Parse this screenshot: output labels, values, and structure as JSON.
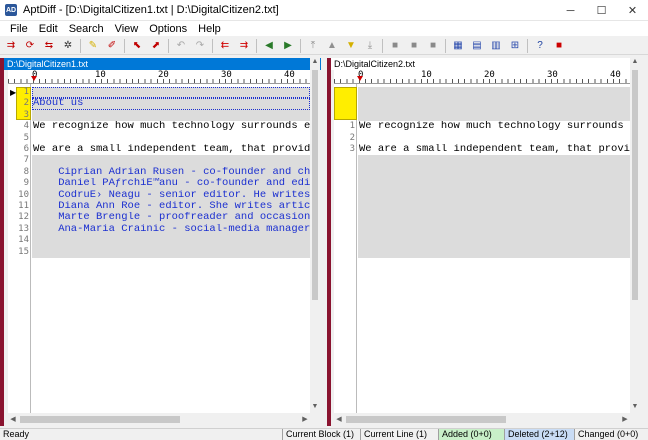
{
  "window": {
    "app_icon": "AD",
    "title": "AptDiff - [D:\\DigitalCitizen1.txt | D:\\DigitalCitizen2.txt]",
    "minimize": "─",
    "maximize": "☐",
    "close": "✕"
  },
  "menu": [
    {
      "label": "File"
    },
    {
      "label": "Edit"
    },
    {
      "label": "Search"
    },
    {
      "label": "View"
    },
    {
      "label": "Options"
    },
    {
      "label": "Help"
    }
  ],
  "toolbar": {
    "icons": [
      "compare-icon",
      "recompare-icon",
      "swap-icon",
      "options-icon",
      "mark-icon",
      "unmark-icon",
      "copy-left-icon",
      "copy-right-icon",
      "undo-icon",
      "redo-icon",
      "move-left-icon",
      "move-right-icon",
      "arrow-left-icon",
      "arrow-right-icon",
      "first-diff-icon",
      "prev-diff-icon",
      "next-diff-icon",
      "last-diff-icon",
      "save-icon",
      "save-left-icon",
      "save-right-icon",
      "report-icon",
      "horizontal-view-icon",
      "vertical-view-icon",
      "merge-view-icon",
      "help-icon",
      "stop-icon"
    ],
    "glyphs": [
      "⇉",
      "⟳",
      "⇆",
      "✲",
      "✎",
      "✐",
      "⬉",
      "⬈",
      "↶",
      "↷",
      "⇇",
      "⇉",
      "◀",
      "▶",
      "⤒",
      "▲",
      "▼",
      "⤓",
      "■",
      "■",
      "■",
      "▦",
      "▤",
      "▥",
      "⊞",
      "?",
      "■"
    ],
    "colors": [
      "#c00000",
      "#c00000",
      "#c00000",
      "#333",
      "#d4b000",
      "#c00000",
      "#c00000",
      "#c00000",
      "#a8a8a8",
      "#a8a8a8",
      "#d00000",
      "#d00000",
      "#2a7a2a",
      "#2a7a2a",
      "#909090",
      "#909090",
      "#d4b000",
      "#909090",
      "#8a8a8a",
      "#8a8a8a",
      "#8a8a8a",
      "#2244aa",
      "#2244aa",
      "#2244aa",
      "#2244aa",
      "#1a3fa0",
      "#cc0000"
    ]
  },
  "left_panel": {
    "header": "D:\\DigitalCitizen1.txt",
    "ruler": [
      "0",
      "10",
      "20",
      "30",
      "40"
    ],
    "line_numbers": [
      "1",
      "2",
      "3",
      "4",
      "5",
      "6",
      "7",
      "8",
      "9",
      "10",
      "11",
      "12",
      "13",
      "14",
      "15"
    ],
    "lines": [
      {
        "text": "",
        "style": "gray"
      },
      {
        "text": "About us",
        "style": "gray-blue"
      },
      {
        "text": "",
        "style": "gray"
      },
      {
        "text": "We recognize how much technology surrounds ever",
        "style": "normal"
      },
      {
        "text": "",
        "style": "normal"
      },
      {
        "text": "We are a small independent team, that provides",
        "style": "normal"
      },
      {
        "text": "",
        "style": "gray"
      },
      {
        "text": "    Ciprian Adrian Rusen - co-founder and chief",
        "style": "gray-blue"
      },
      {
        "text": "    Daniel PÄƒrchiÈ™anu - co-founder and editor",
        "style": "gray-blue"
      },
      {
        "text": "    CodruÈ› Neagu - senior editor. He writes ar",
        "style": "gray-blue"
      },
      {
        "text": "    Diana Ann Roe - editor. She writes articles",
        "style": "gray-blue"
      },
      {
        "text": "    Marte Brengle - proofreader and occasional",
        "style": "gray-blue"
      },
      {
        "text": "    Ana-Maria Crainic - social-media manager. S",
        "style": "gray-blue"
      },
      {
        "text": "",
        "style": "gray"
      },
      {
        "text": "",
        "style": "gray"
      }
    ]
  },
  "right_panel": {
    "header": "D:\\DigitalCitizen2.txt",
    "ruler": [
      "0",
      "10",
      "20",
      "30",
      "40"
    ],
    "line_numbers": [
      "1",
      "2",
      "3"
    ],
    "lines": [
      {
        "text": "We recognize how much technology surrounds ever",
        "style": "normal"
      },
      {
        "text": "",
        "style": "normal"
      },
      {
        "text": "We are a small independent team, that provides",
        "style": "normal"
      }
    ]
  },
  "status": {
    "ready": "Ready",
    "current_block": "Current Block  (1)",
    "current_line": "Current Line  (1)",
    "added": "Added (0+0)",
    "deleted": "Deleted (2+12)",
    "changed": "Changed (0+0)",
    "added_color": "#c8efc8",
    "deleted_color": "#c9dcf5",
    "changed_color": "#f0f0f0"
  },
  "colors": {
    "accent": "#0078d7",
    "diff_marker": "#ffee00",
    "side_bar": "#8a1430",
    "deleted_text": "#1b2fd0",
    "gray_block": "#dcdcdc"
  }
}
